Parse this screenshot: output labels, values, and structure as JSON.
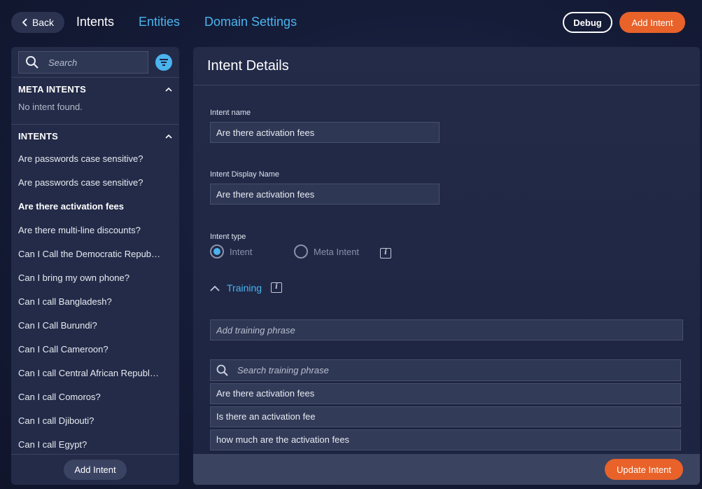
{
  "topbar": {
    "back_label": "Back",
    "tabs": [
      {
        "label": "Intents"
      },
      {
        "label": "Entities"
      },
      {
        "label": "Domain Settings"
      }
    ],
    "debug_label": "Debug",
    "add_intent_label": "Add Intent"
  },
  "sidebar": {
    "search_placeholder": "Search",
    "meta_section_title": "META INTENTS",
    "meta_empty_text": "No intent found.",
    "intents_section_title": "INTENTS",
    "intents": [
      "Are passwords case sensitive?",
      "Are passwords case sensitive?",
      "Are there activation fees",
      "Are there multi-line discounts?",
      "Can I Call the Democratic Repub…",
      "Can I bring my own phone?",
      "Can I call Bangladesh?",
      "Can I Call Burundi?",
      "Can I Call Cameroon?",
      "Can I call Central African Republ…",
      "Can I call Comoros?",
      "Can I call Djibouti?",
      "Can I call Egypt?"
    ],
    "selected_index": 2,
    "add_intent_label": "Add Intent"
  },
  "main": {
    "title": "Intent Details",
    "intent_name_label": "Intent name",
    "intent_name_value": "Are there activation fees",
    "display_name_label": "Intent Display Name",
    "display_name_value": "Are there activation fees",
    "intent_type_label": "Intent type",
    "type_options": [
      "Intent",
      "Meta Intent"
    ],
    "selected_type": "Intent",
    "info_glyph": "i",
    "training_label": "Training",
    "add_phrase_placeholder": "Add training phrase",
    "search_phrase_placeholder": "Search training phrase",
    "phrases": [
      "Are there activation fees",
      "Is there an activation fee",
      "how much are the activation fees"
    ],
    "update_label": "Update Intent"
  },
  "colors": {
    "accent_blue": "#4bb4ee",
    "accent_orange": "#e8622a",
    "panel": "#232b48"
  }
}
